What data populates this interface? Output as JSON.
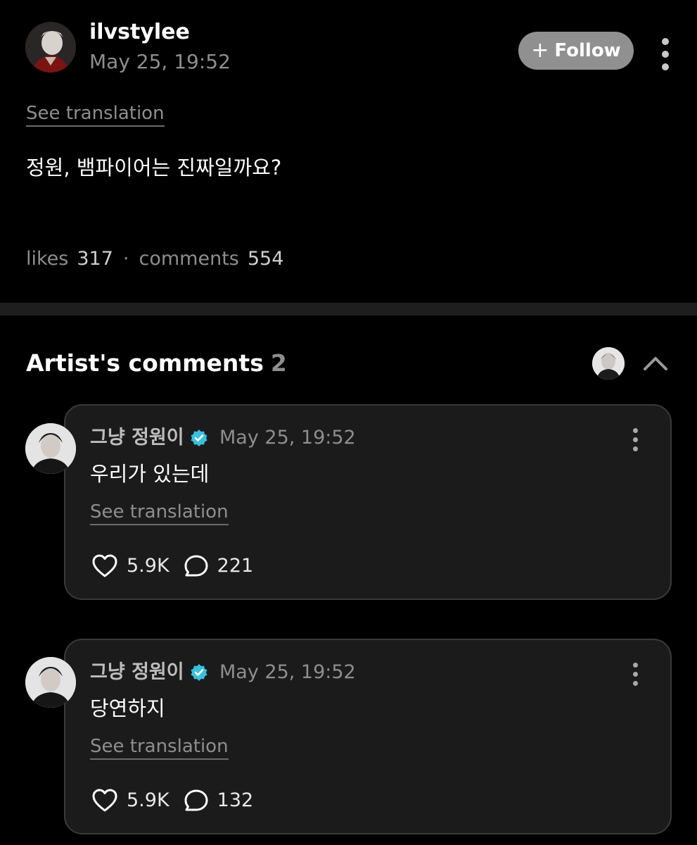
{
  "post": {
    "username": "ilvstylee",
    "date": "May 25, 19:52",
    "follow_label": "Follow",
    "see_translation": "See translation",
    "body": "정원, 뱀파이어는 진짜일까요?",
    "likes_label": "likes",
    "likes_count": "317",
    "separator": "·",
    "comments_label": "comments",
    "comments_count": "554"
  },
  "artist_comments": {
    "title": "Artist's comments",
    "count": "2",
    "items": [
      {
        "name": "그냥 정원이",
        "date": "May 25, 19:52",
        "text": "우리가 있는데",
        "see_translation": "See translation",
        "likes": "5.9K",
        "replies": "221"
      },
      {
        "name": "그냥 정원이",
        "date": "May 25, 19:52",
        "text": "당연하지",
        "see_translation": "See translation",
        "likes": "5.9K",
        "replies": "132"
      }
    ]
  },
  "colors": {
    "background": "#000000",
    "card": "#1b1b1b",
    "muted_text": "#8e8e8e",
    "verified_badge": "#3bc0dc",
    "follow_button": "#909090"
  },
  "icons": [
    "more-vertical-icon",
    "plus-icon",
    "verified-badge-icon",
    "heart-icon",
    "comment-bubble-icon",
    "chevron-up-icon"
  ]
}
